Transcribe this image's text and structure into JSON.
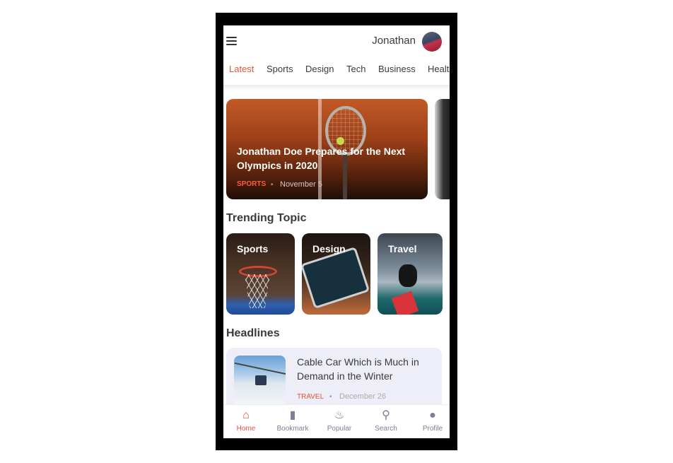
{
  "header": {
    "username": "Jonathan",
    "menu_icon": "hamburger-menu-icon",
    "avatar_icon": "user-avatar"
  },
  "tabs": [
    {
      "label": "Latest",
      "active": true
    },
    {
      "label": "Sports"
    },
    {
      "label": "Design"
    },
    {
      "label": "Tech"
    },
    {
      "label": "Business"
    },
    {
      "label": "Healt"
    }
  ],
  "featured": {
    "title": "Jonathan Doe Prepares for the Next Olympics in 2020",
    "category": "SPORTS",
    "date": "November 5",
    "separator": "•"
  },
  "trending": {
    "title": "Trending Topic",
    "topics": [
      {
        "label": "Sports"
      },
      {
        "label": "Design"
      },
      {
        "label": "Travel"
      }
    ]
  },
  "headlines": {
    "title": "Headlines",
    "items": [
      {
        "title": "Cable Car Which is Much in Demand in the Winter",
        "category": "TRAVEL",
        "date": "December 26",
        "separator": "•"
      }
    ]
  },
  "bottom_nav": {
    "items": [
      {
        "label": "Home",
        "icon": "home-icon",
        "glyph": "⌂",
        "active": true
      },
      {
        "label": "Bookmark",
        "icon": "bookmark-icon",
        "glyph": "▮"
      },
      {
        "label": "Popular",
        "icon": "fire-icon",
        "glyph": "♨"
      },
      {
        "label": "Search",
        "icon": "search-icon",
        "glyph": "⚲"
      },
      {
        "label": "Profile",
        "icon": "profile-icon",
        "glyph": "●"
      }
    ]
  },
  "colors": {
    "accent": "#e8533b",
    "text": "#3a3a3a",
    "nav_inactive": "#7d7d96",
    "card_bg": "#eeeef8"
  }
}
